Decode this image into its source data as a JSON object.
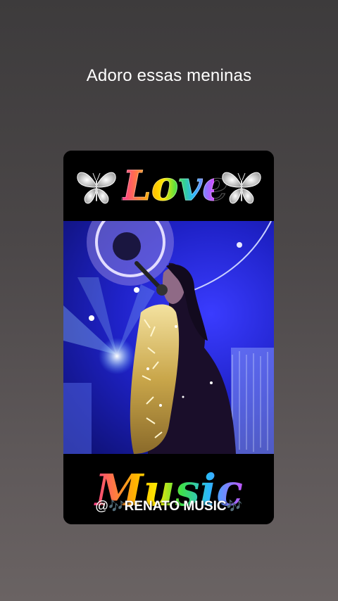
{
  "story": {
    "caption": "Adoro essas meninas"
  },
  "sticker": {
    "top_text": "Love",
    "bottom_text": "Music",
    "watermark_prefix": "@",
    "watermark_note_left": "🎶",
    "watermark_name": "RENATO MUSIC",
    "watermark_note_right": "🎶",
    "icons": [
      "butterfly-icon",
      "butterfly-icon",
      "music-note-icon"
    ]
  },
  "colors": {
    "background_top": "#3d3b3c",
    "background_bottom": "#6a6363",
    "stage_blue": "#1f22c8",
    "watermark_note": "#b27bff"
  }
}
